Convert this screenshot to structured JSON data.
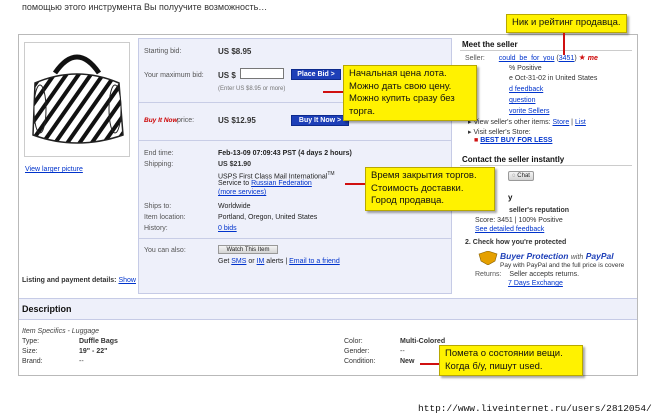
{
  "top_caption": "помощью этого инструмента Вы полуучите возможность…",
  "bid": {
    "starting_label": "Starting bid:",
    "starting_value": "US $8.95",
    "max_label": "Your maximum bid:",
    "currency": "US $",
    "place_bid": "Place Bid >",
    "hint": "(Enter US $8.95 or more)",
    "bin_logo": "Buy It Now",
    "bin_suffix": "price:",
    "bin_value": "US $12.95",
    "bin_button": "Buy It Now >"
  },
  "image": {
    "view_larger": "View larger picture"
  },
  "details": {
    "end_label": "End time:",
    "end_value": "Feb-13-09 07:09:43 PST (4 days 2 hours)",
    "ship_label": "Shipping:",
    "ship_price": "US $21.90",
    "ship_service": "USPS First Class Mail International",
    "ship_tm": "TM",
    "ship_to_prefix": "Service to",
    "ship_country": "Russian Federation",
    "more_services": "(more services)",
    "ships_to_label": "Ships to:",
    "ships_to_value": "Worldwide",
    "location_label": "Item location:",
    "location_value": "Portland, Oregon, United States",
    "history_label": "History:",
    "history_value": "0 bids",
    "also_label": "You can also:",
    "watch_button": "Watch This Item",
    "get_prefix": "Get",
    "sms": "SMS",
    "or": "or",
    "im": "IM",
    "alerts": "alerts |",
    "email_friend": "Email to a friend"
  },
  "listing": {
    "label": "Listing and payment details:",
    "show": "Show"
  },
  "seller": {
    "title": "Meet the seller",
    "seller_label": "Seller:",
    "seller_name": "could_be_for_you",
    "open_paren": "(",
    "score": "3451",
    "close_paren": ")",
    "me": "me",
    "positive": "% Positive",
    "since": "e Oct-31-02 in United States",
    "feedback": "d feedback",
    "ask": "question",
    "favorite": "vorite Sellers",
    "other_items_prefix": "View seller's other items:",
    "store": "Store",
    "list": "List",
    "visit_store": "Visit seller's Store:",
    "store_name": "BEST BUY FOR LESS"
  },
  "contact": {
    "title": "Contact the seller instantly",
    "chat": "Chat"
  },
  "safety": {
    "title_tail": "y",
    "rep_title": "seller's reputation",
    "rep_score": "Score: 3451 | 100% Positive",
    "rep_link": "See detailed feedback",
    "protect_title": "2. Check how you're protected",
    "bp_title": "Buyer Protection",
    "bp_with": "with",
    "bp_paypal": "PayPal",
    "bp_sub": "Pay with PayPal and the full price is covere",
    "returns_label": "Returns:",
    "returns_value": "Seller accepts returns.",
    "returns_link": "7 Days Exchange"
  },
  "description": {
    "title": "Description",
    "specifics": "Item Specifics - Luggage",
    "rows": [
      {
        "l": "Type:",
        "v": "Duffle Bags",
        "r": "Color:",
        "rv": "Multi-Colored"
      },
      {
        "l": "Size:",
        "v": "19\" - 22\"",
        "r": "Gender:",
        "rv": "--"
      },
      {
        "l": "Brand:",
        "v": "--",
        "r": "Condition:",
        "rv": "New"
      }
    ]
  },
  "notes": {
    "seller_note": "Ник и рейтинг продавца.",
    "price_note": [
      "Начальная цена лота.",
      "Можно дать свою цену.",
      "Можно купить сразу без торга."
    ],
    "time_note": [
      "Время закрытия торгов.",
      "Стоимость доставки.",
      "Город продавца."
    ],
    "cond_note": [
      "Помета о состоянии вещи.",
      "Когда б/у, пишут used."
    ]
  },
  "footer_url": "http://www.liveinternet.ru/users/2812054/",
  "colors": {
    "note_yellow": "#fff200",
    "arrow_red": "#d01010",
    "ebay_blue": "#1d3fb8",
    "link_blue": "#0033cc"
  }
}
